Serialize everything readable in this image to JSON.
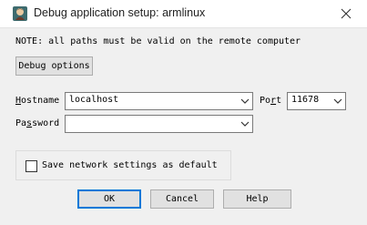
{
  "window": {
    "title": "Debug application setup: armlinux"
  },
  "note": "NOTE: all paths must be valid on the remote computer",
  "debug_options_button": "Debug options",
  "hostname": {
    "label_pre": "",
    "label_ul": "H",
    "label_post": "ostname",
    "value": "localhost"
  },
  "port": {
    "label_pre": "Po",
    "label_ul": "r",
    "label_post": "t",
    "value": "11678"
  },
  "password": {
    "label_pre": "Pa",
    "label_ul": "s",
    "label_post": "sword",
    "value": ""
  },
  "save_settings": {
    "checked": false,
    "label": "Save network settings as default"
  },
  "buttons": {
    "ok": "OK",
    "cancel": "Cancel",
    "help": "Help"
  },
  "colors": {
    "accent": "#0078d7",
    "background": "#f0f0f0"
  }
}
